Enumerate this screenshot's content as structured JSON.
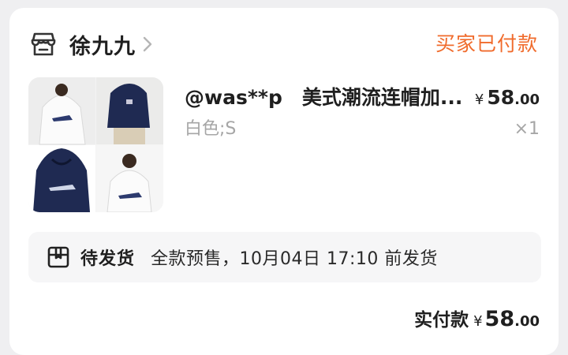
{
  "shop": {
    "name": "徐九九",
    "icon": "store-icon",
    "chevron_icon": "chevron-right-icon"
  },
  "order": {
    "status": "买家已付款"
  },
  "product": {
    "title": "@was**p　美式潮流连帽加...",
    "price_symbol": "¥",
    "price_integer": "58",
    "price_decimal": ".00",
    "sku": "白色;S",
    "quantity": "×1",
    "image_icon": "product-photo-hoodie"
  },
  "shipping": {
    "icon": "package-box-icon",
    "status": "待发货",
    "note": "全款预售，10月04日 17:10 前发货"
  },
  "payment": {
    "label": "实付款",
    "symbol": "¥",
    "integer": "58",
    "decimal": ".00"
  },
  "colors": {
    "accent_orange": "#f06b2c",
    "muted_gray": "#a6a6a6",
    "navy_hoodie": "#1f2a52"
  }
}
